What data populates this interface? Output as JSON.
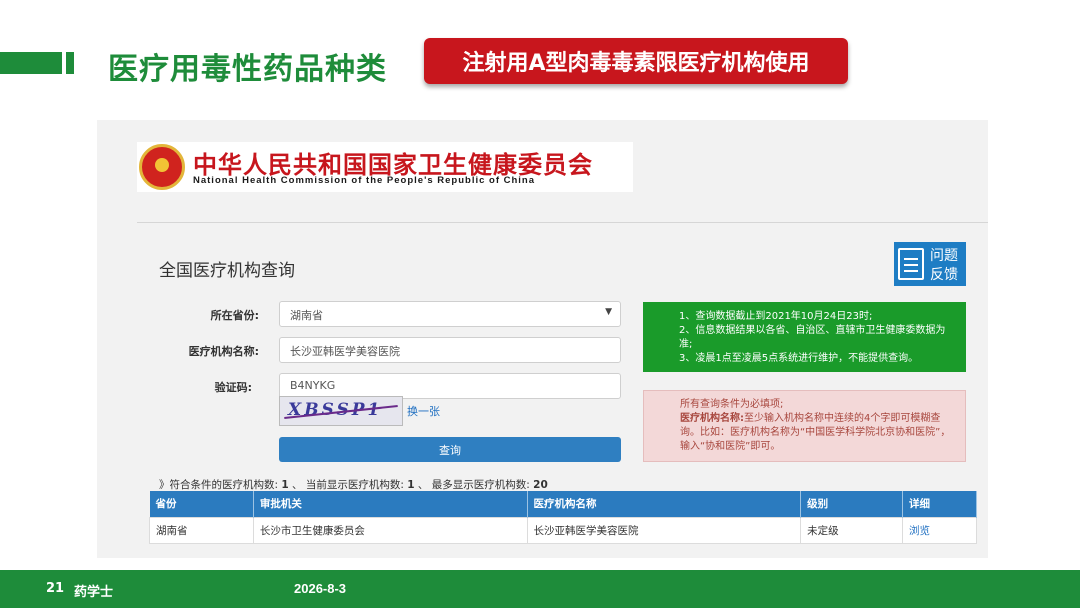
{
  "header": {
    "title": "医疗用毒性药品种类",
    "badge": "注射用A型肉毒毒素限医疗机构使用"
  },
  "logo": {
    "cn": "中华人民共和国国家卫生健康委员会",
    "en": "National Health Commission of the People's Republic of China"
  },
  "query": {
    "title": "全国医疗机构查询",
    "feedback_line1": "问题",
    "feedback_line2": "反馈",
    "province_label": "所在省份:",
    "province_value": "湖南省",
    "name_label": "医疗机构名称:",
    "name_value": "长沙亚韩医学美容医院",
    "code_label": "验证码:",
    "code_value": "B4NYKG",
    "captcha_text": "XBSSP1",
    "refresh_label": "换一张",
    "submit_label": "查询"
  },
  "notice": {
    "green": [
      "1、查询数据截止到2021年10月24日23时;",
      "2、信息数据结果以各省、自治区、直辖市卫生健康委数据为准;",
      "3、凌晨1点至凌晨5点系统进行维护，不能提供查询。"
    ],
    "red_line1": "所有查询条件为必填项;",
    "red_bold": "医疗机构名称:",
    "red_rest": "至少输入机构名称中连续的4个字即可模糊查询。比如：医疗机构名称为“中国医学科学院北京协和医院”，输入“协和医院”即可。"
  },
  "summary": {
    "prefix": "》符合条件的医疗机构数:",
    "match_count": "1",
    "current_label": "、 当前显示医疗机构数:",
    "current_count": "1",
    "max_label": "、 最多显示医疗机构数:",
    "max_count": "20"
  },
  "table": {
    "headers": [
      "省份",
      "审批机关",
      "医疗机构名称",
      "级别",
      "详细"
    ],
    "rows": [
      [
        "湖南省",
        "长沙市卫生健康委员会",
        "长沙亚韩医学美容医院",
        "未定级",
        "浏览"
      ]
    ]
  },
  "footer": {
    "page_number": "21",
    "name": "药学士",
    "date": "2026-8-3"
  },
  "colors": {
    "brand_green": "#1e8c3a",
    "badge_red": "#c8161d",
    "table_blue": "#2b7bbf"
  }
}
